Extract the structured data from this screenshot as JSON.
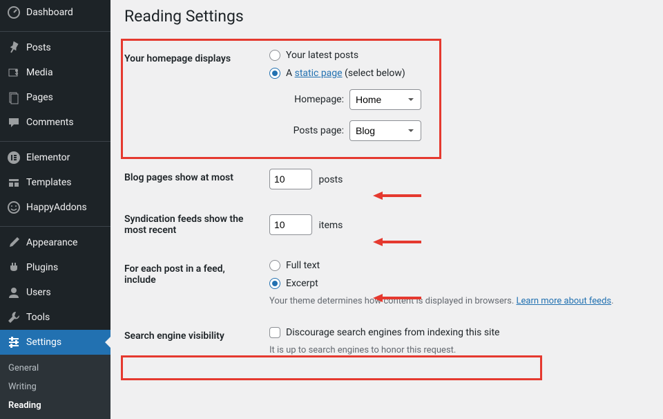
{
  "sidebar": {
    "items": [
      {
        "label": "Dashboard"
      },
      {
        "label": "Posts"
      },
      {
        "label": "Media"
      },
      {
        "label": "Pages"
      },
      {
        "label": "Comments"
      },
      {
        "label": "Elementor"
      },
      {
        "label": "Templates"
      },
      {
        "label": "HappyAddons"
      },
      {
        "label": "Appearance"
      },
      {
        "label": "Plugins"
      },
      {
        "label": "Users"
      },
      {
        "label": "Tools"
      },
      {
        "label": "Settings"
      }
    ],
    "submenu": [
      {
        "label": "General"
      },
      {
        "label": "Writing"
      },
      {
        "label": "Reading"
      }
    ]
  },
  "page": {
    "title": "Reading Settings"
  },
  "homepage": {
    "heading": "Your homepage displays",
    "option_latest": "Your latest posts",
    "option_static_prefix": "A ",
    "option_static_link": "static page",
    "option_static_suffix": " (select below)",
    "homepage_label": "Homepage:",
    "homepage_value": "Home",
    "postspage_label": "Posts page:",
    "postspage_value": "Blog"
  },
  "blog_pages": {
    "heading": "Blog pages show at most",
    "value": "10",
    "unit": "posts"
  },
  "syndication": {
    "heading": "Syndication feeds show the most recent",
    "value": "10",
    "unit": "items"
  },
  "feed_include": {
    "heading": "For each post in a feed, include",
    "option_full": "Full text",
    "option_excerpt": "Excerpt",
    "desc_prefix": "Your theme determines how content is displayed in browsers. ",
    "desc_link": "Learn more about feeds",
    "desc_suffix": "."
  },
  "search_visibility": {
    "heading": "Search engine visibility",
    "checkbox_label": "Discourage search engines from indexing this site",
    "desc": "It is up to search engines to honor this request."
  }
}
